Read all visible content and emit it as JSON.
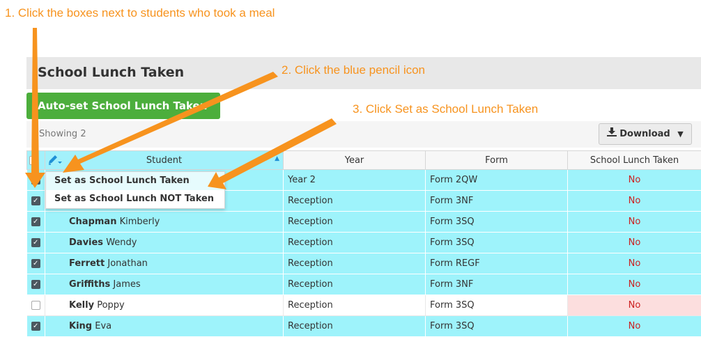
{
  "annotations": {
    "step1": "1. Click the boxes next to students who took a meal",
    "step2": "2. Click the blue pencil icon",
    "step3": "3. Click Set as School Lunch Taken"
  },
  "panel": {
    "title": "School Lunch Taken",
    "autoset_label": "Auto-set School Lunch Taken",
    "showing_text": "Showing 2",
    "download_label": "Download"
  },
  "table": {
    "columns": [
      "Student",
      "Year",
      "Form",
      "School Lunch Taken"
    ],
    "rows": [
      {
        "checked": true,
        "surname": "",
        "forename": "",
        "year": "Year 2",
        "form": "Form 2QW",
        "lunch": "No"
      },
      {
        "checked": true,
        "surname": "",
        "forename": "",
        "year": "Reception",
        "form": "Form 3NF",
        "lunch": "No"
      },
      {
        "checked": true,
        "surname": "Chapman",
        "forename": "Kimberly",
        "year": "Reception",
        "form": "Form 3SQ",
        "lunch": "No"
      },
      {
        "checked": true,
        "surname": "Davies",
        "forename": "Wendy",
        "year": "Reception",
        "form": "Form 3SQ",
        "lunch": "No"
      },
      {
        "checked": true,
        "surname": "Ferrett",
        "forename": "Jonathan",
        "year": "Reception",
        "form": "Form REGF",
        "lunch": "No"
      },
      {
        "checked": true,
        "surname": "Griffiths",
        "forename": "James",
        "year": "Reception",
        "form": "Form 3NF",
        "lunch": "No"
      },
      {
        "checked": false,
        "surname": "Kelly",
        "forename": "Poppy",
        "year": "Reception",
        "form": "Form 3SQ",
        "lunch": "No"
      },
      {
        "checked": true,
        "surname": "King",
        "forename": "Eva",
        "year": "Reception",
        "form": "Form 3SQ",
        "lunch": "No"
      }
    ]
  },
  "menu": {
    "items": [
      "Set as School Lunch Taken",
      "Set as School Lunch NOT Taken"
    ]
  },
  "icons": {
    "pencil": "pencil-icon",
    "download": "download-icon",
    "sort": "sort-asc-icon",
    "checkbox": "checkbox-icon"
  },
  "colors": {
    "annotation": "#f7931e",
    "row_selected": "#9ef3fb",
    "auto_set_button": "#4cae3c",
    "no_value": "#cc1f1f",
    "pencil": "#1e90d6"
  }
}
